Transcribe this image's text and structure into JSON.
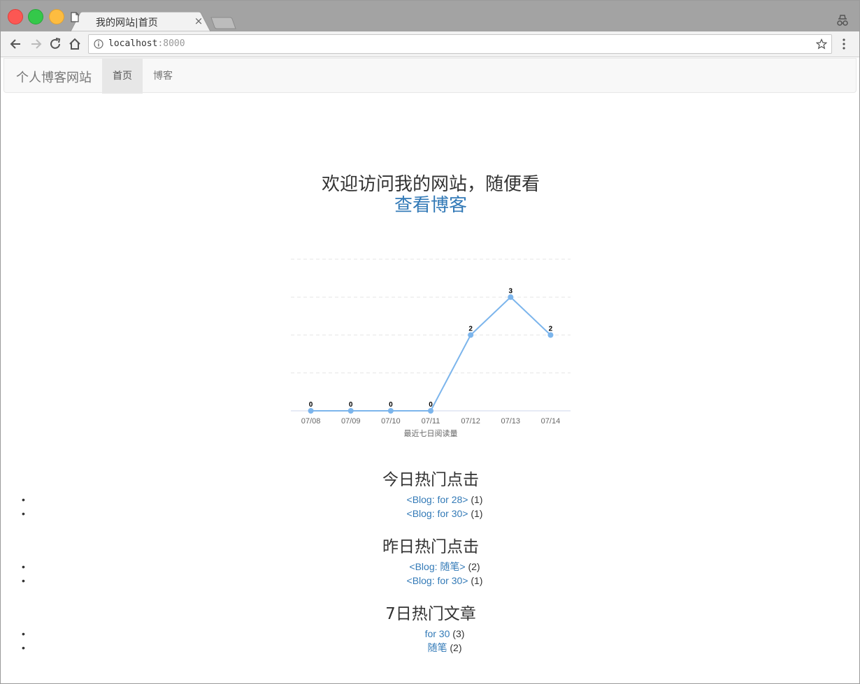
{
  "browser": {
    "tab_title": "我的网站|首页",
    "tab_close": "×",
    "url_host": "localhost",
    "url_port": ":8000"
  },
  "navbar": {
    "brand": "个人博客网站",
    "items": [
      {
        "label": "首页",
        "active": true
      },
      {
        "label": "博客",
        "active": false
      }
    ]
  },
  "hero": {
    "text": "欢迎访问我的网站，随便看",
    "link": "查看博客"
  },
  "chart_data": {
    "type": "line",
    "categories": [
      "07/08",
      "07/09",
      "07/10",
      "07/11",
      "07/12",
      "07/13",
      "07/14"
    ],
    "values": [
      0,
      0,
      0,
      0,
      2,
      3,
      2
    ],
    "xlabel": "最近七日阅读量",
    "ylim": [
      0,
      4
    ],
    "grid": true,
    "color": "#7cb5ec"
  },
  "sections": [
    {
      "title": "今日热门点击",
      "items": [
        {
          "link": "<Blog: for 28>",
          "count": "(1)"
        },
        {
          "link": "<Blog: for 30>",
          "count": "(1)"
        }
      ]
    },
    {
      "title": "昨日热门点击",
      "items": [
        {
          "link": "<Blog: 随笔>",
          "count": "(2)"
        },
        {
          "link": "<Blog: for 30>",
          "count": "(1)"
        }
      ]
    },
    {
      "title": "7日热门文章",
      "items": [
        {
          "link": "for 30",
          "count": "(3)"
        },
        {
          "link": "随笔",
          "count": "(2)"
        }
      ]
    }
  ]
}
